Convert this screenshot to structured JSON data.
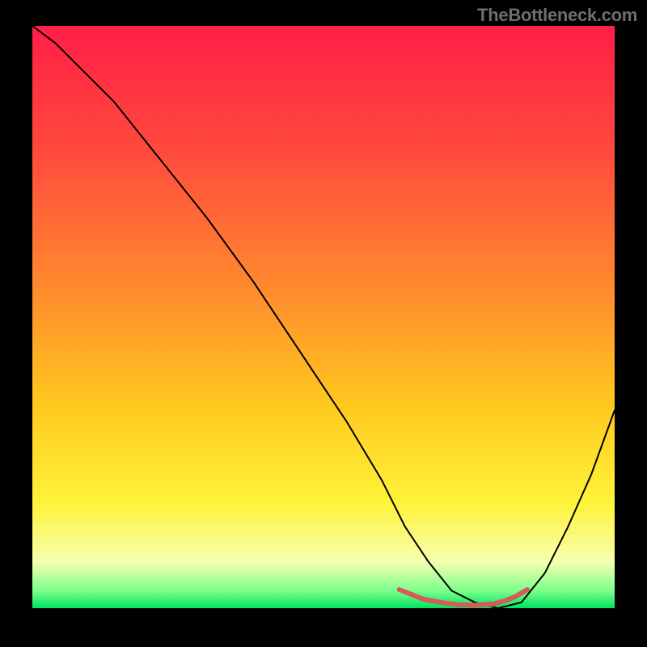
{
  "watermark": "TheBottleneck.com",
  "chart_data": {
    "type": "line",
    "title": "",
    "xlabel": "",
    "ylabel": "",
    "xlim": [
      0,
      100
    ],
    "ylim": [
      0,
      100
    ],
    "grid": false,
    "background_gradient_stops": [
      {
        "offset": 0,
        "color": "#ff1e46"
      },
      {
        "offset": 22,
        "color": "#ff4b3d"
      },
      {
        "offset": 45,
        "color": "#ff8a2e"
      },
      {
        "offset": 65,
        "color": "#ffc81f"
      },
      {
        "offset": 82,
        "color": "#fff33a"
      },
      {
        "offset": 92,
        "color": "#f6ffb0"
      },
      {
        "offset": 97,
        "color": "#7dff8b"
      },
      {
        "offset": 100,
        "color": "#00e25e"
      }
    ],
    "series": [
      {
        "name": "bottleneck-curve",
        "color": "#000000",
        "stroke_width": 2,
        "x": [
          0,
          4,
          8,
          14,
          22,
          30,
          38,
          46,
          54,
          60,
          64,
          68,
          72,
          76,
          80,
          84,
          88,
          92,
          96,
          100
        ],
        "values": [
          100,
          97,
          93,
          87,
          77,
          67,
          56,
          44,
          32,
          22,
          14,
          8,
          3,
          1,
          0,
          1,
          6,
          14,
          23,
          34
        ]
      },
      {
        "name": "optimal-zone-marker",
        "color": "#d55a5a",
        "stroke_width": 6,
        "x": [
          63,
          65,
          67,
          70,
          73,
          76,
          79,
          81,
          83,
          85
        ],
        "values": [
          3.2,
          2.4,
          1.6,
          1.0,
          0.6,
          0.5,
          0.7,
          1.2,
          2.0,
          3.2
        ]
      }
    ]
  }
}
